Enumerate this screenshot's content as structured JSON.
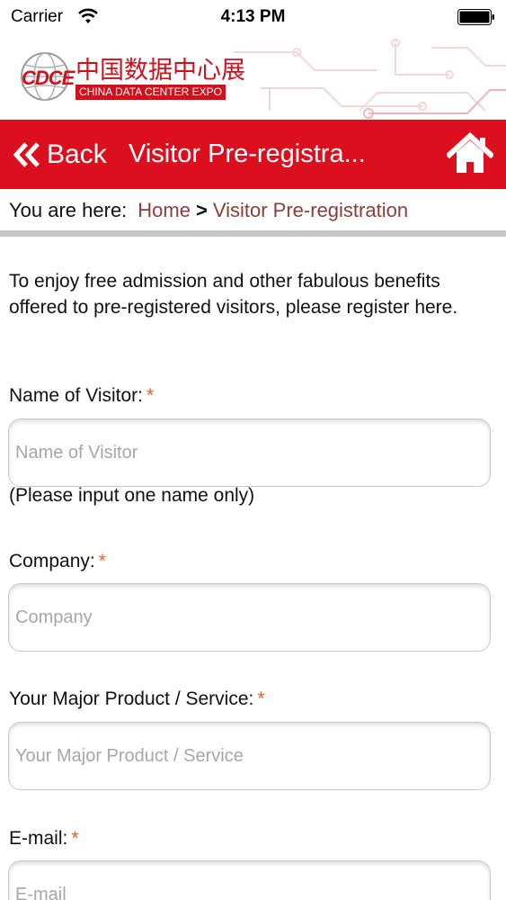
{
  "status_bar": {
    "carrier": "Carrier",
    "time": "4:13 PM"
  },
  "brand": {
    "logo_abbr": "CDCE",
    "name_cn": "中国数据中心展",
    "name_en": "CHINA DATA CENTER EXPO",
    "color": "#dc0f1e"
  },
  "navbar": {
    "back_label": "Back",
    "title": "Visitor Pre-registra...",
    "home_icon": "home-icon"
  },
  "breadcrumb": {
    "prefix": "You are here:",
    "home": "Home",
    "separator": ">",
    "current": "Visitor Pre-registration"
  },
  "intro": "To enjoy free admission and other fabulous benefits offered to pre-registered visitors, please register here.",
  "form": {
    "required_mark": "*",
    "fields": [
      {
        "label": "Name of Visitor:",
        "placeholder": "Name of Visitor",
        "value": "",
        "hint": "(Please input one name only)"
      },
      {
        "label": "Company:",
        "placeholder": "Company",
        "value": ""
      },
      {
        "label": "Your Major Product / Service:",
        "placeholder": "Your Major Product / Service",
        "value": ""
      },
      {
        "label": "E-mail:",
        "placeholder": "E-mail",
        "value": ""
      }
    ]
  },
  "colors": {
    "accent": "#dc0f1e",
    "link": "#8b3e3a",
    "required": "#e0641e"
  }
}
